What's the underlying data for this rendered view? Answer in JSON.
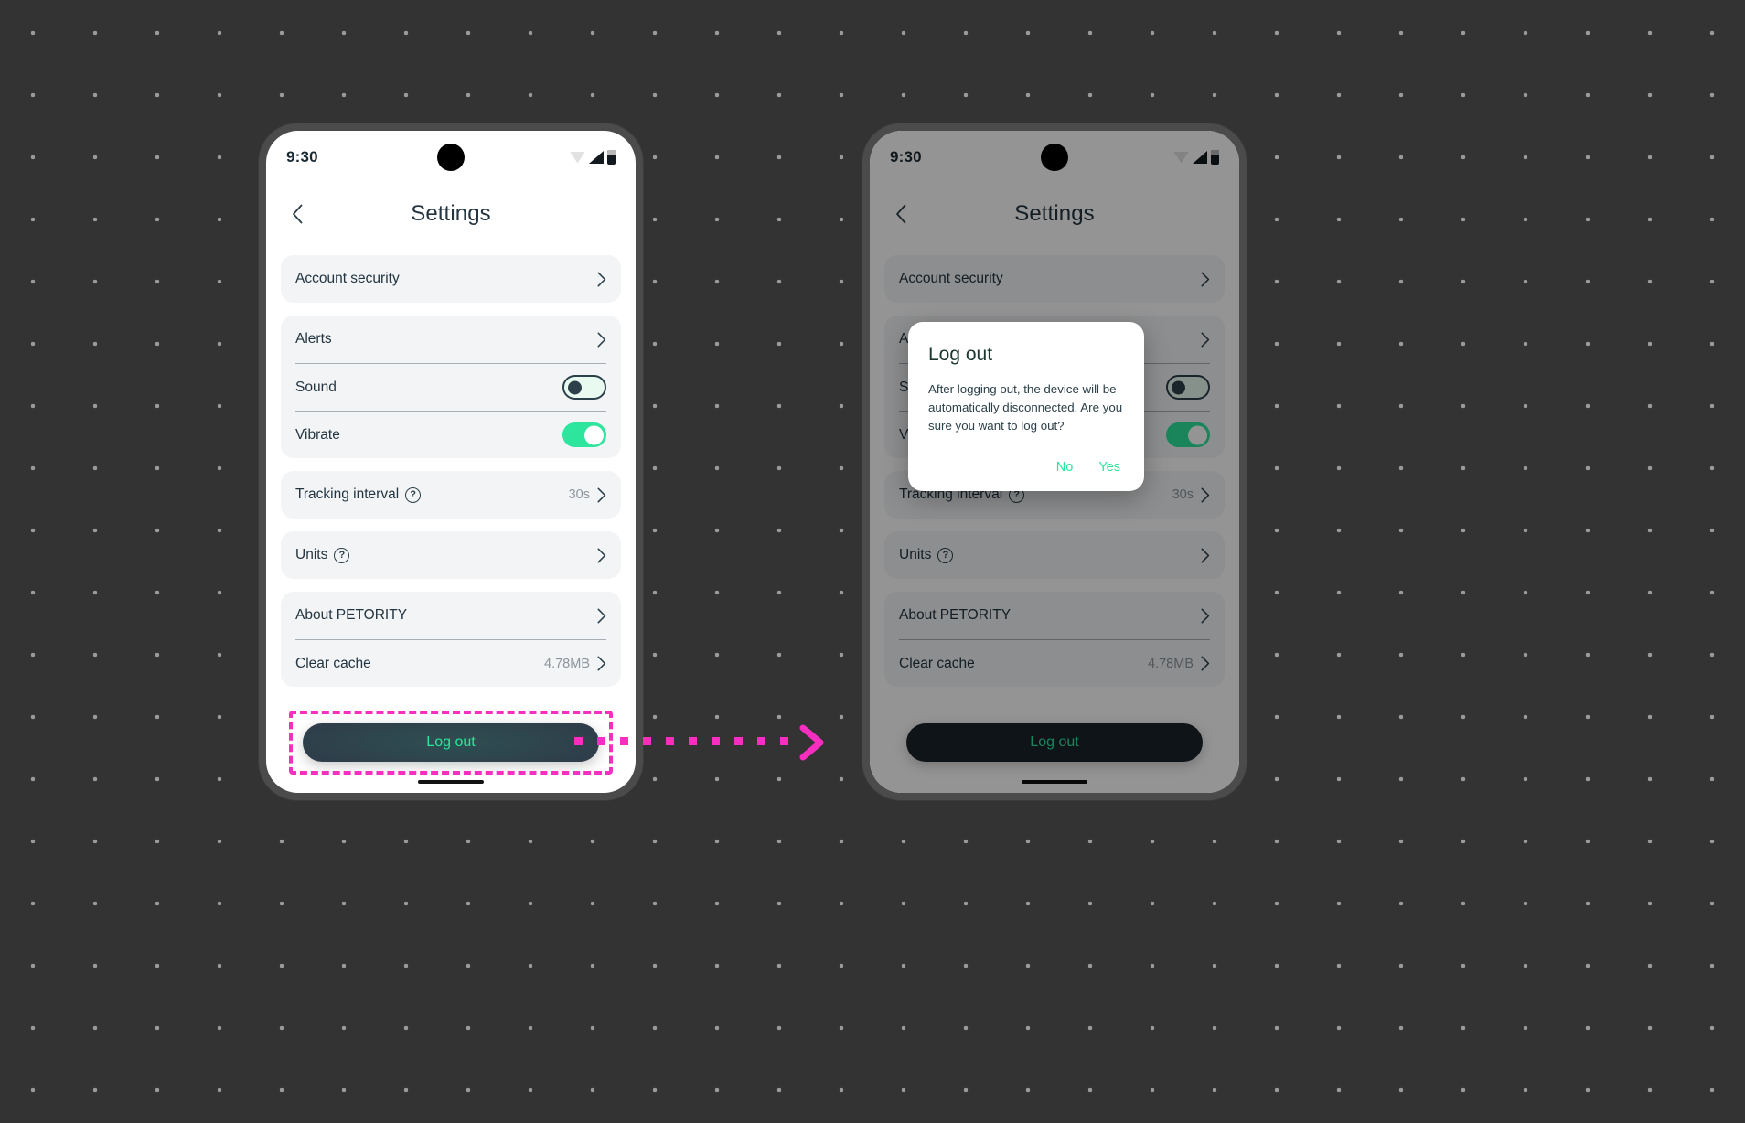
{
  "canvas": {
    "background_color": "#333333",
    "dot_color": "#9a9a9a"
  },
  "accent": {
    "mint_green": "#2EE59D",
    "dark_navy": "#2F3E4A",
    "highlight_magenta": "#F72EC0"
  },
  "status_bar": {
    "time": "9:30",
    "wifi_icon": "wifi-icon",
    "signal_icon": "signal-bars-icon",
    "battery_icon": "battery-icon"
  },
  "header": {
    "back_icon": "chevron-left-icon",
    "title": "Settings"
  },
  "settings": {
    "groups": [
      {
        "rows": [
          {
            "label": "Account security",
            "type": "link",
            "value": "",
            "chevron": true,
            "help": false
          }
        ]
      },
      {
        "rows": [
          {
            "label": "Alerts",
            "type": "link",
            "value": "",
            "chevron": true,
            "help": false
          },
          {
            "label": "Sound",
            "type": "toggle",
            "state": "off",
            "help": false
          },
          {
            "label": "Vibrate",
            "type": "toggle",
            "state": "on",
            "help": false
          }
        ]
      },
      {
        "rows": [
          {
            "label": "Tracking interval",
            "type": "link",
            "value": "30s",
            "chevron": true,
            "help": true,
            "help_glyph": "?"
          }
        ]
      },
      {
        "rows": [
          {
            "label": "Units",
            "type": "link",
            "value": "",
            "chevron": true,
            "help": true,
            "help_glyph": "?"
          }
        ]
      },
      {
        "rows": [
          {
            "label": "About PETORITY",
            "type": "link",
            "value": "",
            "chevron": true,
            "help": false
          },
          {
            "label": "Clear cache",
            "type": "link",
            "value": "4.78MB",
            "chevron": true,
            "help": false
          }
        ]
      }
    ],
    "logout_label": "Log out"
  },
  "dialog": {
    "title": "Log out",
    "message": "After logging out, the device will be automatically disconnected. Are you sure you want to log out?",
    "no_label": "No",
    "yes_label": "Yes"
  },
  "annotation": {
    "highlight_target": "Log out",
    "arrow_icon": "chevron-right-arrow-icon"
  }
}
